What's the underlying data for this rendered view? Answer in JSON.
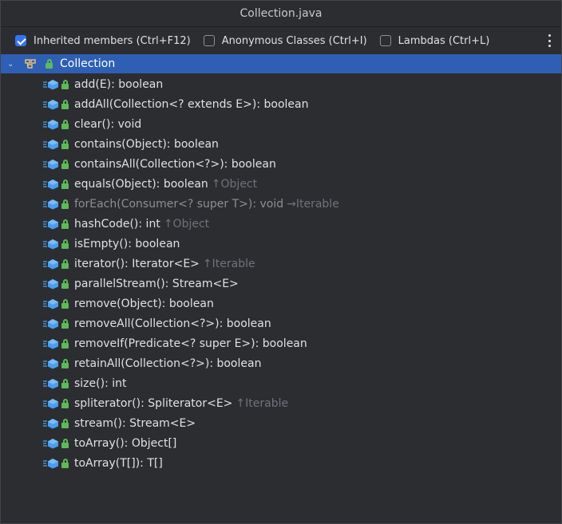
{
  "window": {
    "title": "Collection.java"
  },
  "toolbar": {
    "options": [
      {
        "label": "Inherited members (Ctrl+F12)",
        "checked": true
      },
      {
        "label": "Anonymous Classes (Ctrl+I)",
        "checked": false
      },
      {
        "label": "Lambdas (Ctrl+L)",
        "checked": false
      }
    ]
  },
  "tree": {
    "root": {
      "label": "Collection"
    },
    "members": [
      {
        "sig": "add(E): boolean",
        "inherited": ""
      },
      {
        "sig": "addAll(Collection<? extends E>): boolean",
        "inherited": ""
      },
      {
        "sig": "clear(): void",
        "inherited": ""
      },
      {
        "sig": "contains(Object): boolean",
        "inherited": ""
      },
      {
        "sig": "containsAll(Collection<?>): boolean",
        "inherited": ""
      },
      {
        "sig": "equals(Object): boolean",
        "inherited": "↑Object"
      },
      {
        "sig": "forEach(Consumer<? super T>): void",
        "inherited": "→Iterable",
        "dim": true
      },
      {
        "sig": "hashCode(): int",
        "inherited": "↑Object"
      },
      {
        "sig": "isEmpty(): boolean",
        "inherited": ""
      },
      {
        "sig": "iterator(): Iterator<E>",
        "inherited": "↑Iterable"
      },
      {
        "sig": "parallelStream(): Stream<E>",
        "inherited": ""
      },
      {
        "sig": "remove(Object): boolean",
        "inherited": ""
      },
      {
        "sig": "removeAll(Collection<?>): boolean",
        "inherited": ""
      },
      {
        "sig": "removeIf(Predicate<? super E>): boolean",
        "inherited": ""
      },
      {
        "sig": "retainAll(Collection<?>): boolean",
        "inherited": ""
      },
      {
        "sig": "size(): int",
        "inherited": ""
      },
      {
        "sig": "spliterator(): Spliterator<E>",
        "inherited": "↑Iterable"
      },
      {
        "sig": "stream(): Stream<E>",
        "inherited": ""
      },
      {
        "sig": "toArray(): Object[]",
        "inherited": ""
      },
      {
        "sig": "toArray(T[]): T[]",
        "inherited": ""
      }
    ]
  },
  "colors": {
    "selection": "#2e5fb4",
    "accent": "#3574f0",
    "method_icon": "#4a9ef1",
    "lock_icon": "#5fb85a",
    "inherited_text": "#6f737a"
  },
  "icons": {
    "root": "interface-icon",
    "member": "method-icon",
    "access": "public-lock-icon",
    "more": "more-vertical-icon"
  }
}
